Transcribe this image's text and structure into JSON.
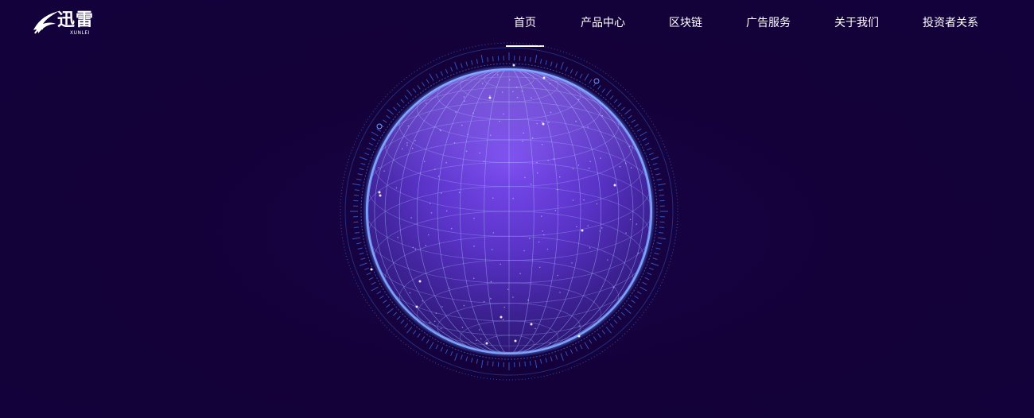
{
  "brand": {
    "name": "迅雷",
    "sub": "XUNLEI",
    "logo_icon": "bird-swoosh-icon"
  },
  "nav": {
    "items": [
      {
        "label": "首页",
        "active": true
      },
      {
        "label": "产品中心",
        "active": false
      },
      {
        "label": "区块链",
        "active": false
      },
      {
        "label": "广告服务",
        "active": false
      },
      {
        "label": "关于我们",
        "active": false
      },
      {
        "label": "投资者关系",
        "active": false
      }
    ]
  },
  "hero": {
    "visual": "globe-grid-icon"
  },
  "colors": {
    "background": "#14013a",
    "globe_core": "#6a3fe0",
    "globe_edge": "#2b66d6",
    "text": "#ffffff"
  }
}
